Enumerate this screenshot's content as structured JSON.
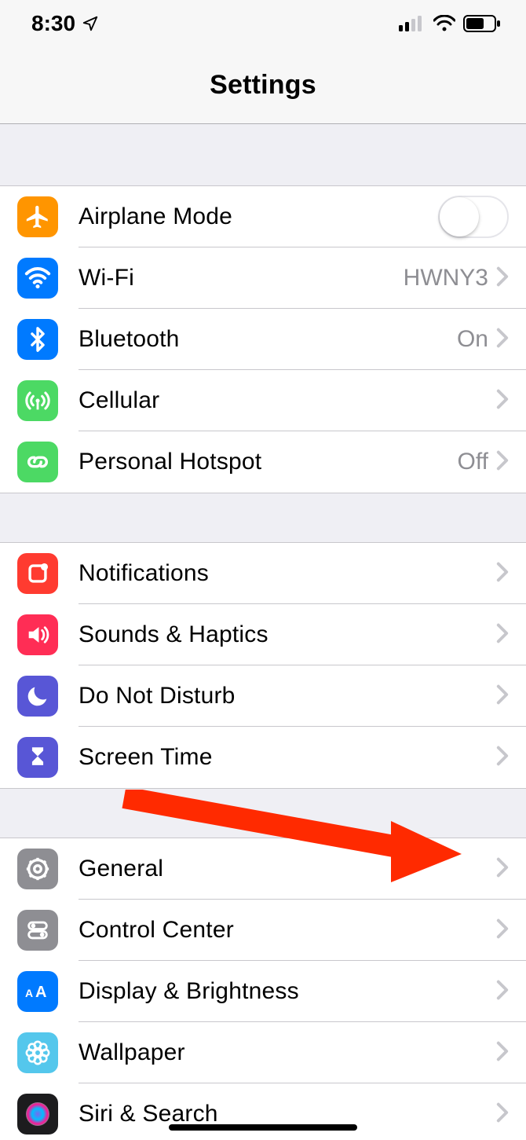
{
  "status": {
    "time": "8:30",
    "location_icon": "location-arrow",
    "signal_bars": 2,
    "wifi": true,
    "battery_pct": 60
  },
  "header": {
    "title": "Settings"
  },
  "groups": [
    {
      "rows": [
        {
          "id": "airplane-mode",
          "icon": "airplane",
          "icon_bg": "#ff9500",
          "label": "Airplane Mode",
          "control": "switch",
          "switch_on": false
        },
        {
          "id": "wifi",
          "icon": "wifi",
          "icon_bg": "#007aff",
          "label": "Wi-Fi",
          "value": "HWNY3",
          "control": "disclosure"
        },
        {
          "id": "bluetooth",
          "icon": "bluetooth",
          "icon_bg": "#007aff",
          "label": "Bluetooth",
          "value": "On",
          "control": "disclosure"
        },
        {
          "id": "cellular",
          "icon": "antenna",
          "icon_bg": "#4cd964",
          "label": "Cellular",
          "control": "disclosure"
        },
        {
          "id": "personal-hotspot",
          "icon": "link",
          "icon_bg": "#4cd964",
          "label": "Personal Hotspot",
          "value": "Off",
          "control": "disclosure"
        }
      ]
    },
    {
      "rows": [
        {
          "id": "notifications",
          "icon": "notifications",
          "icon_bg": "#ff3b30",
          "label": "Notifications",
          "control": "disclosure"
        },
        {
          "id": "sounds",
          "icon": "speaker",
          "icon_bg": "#ff2d55",
          "label": "Sounds & Haptics",
          "control": "disclosure"
        },
        {
          "id": "dnd",
          "icon": "moon",
          "icon_bg": "#5856d6",
          "label": "Do Not Disturb",
          "control": "disclosure"
        },
        {
          "id": "screen-time",
          "icon": "hourglass",
          "icon_bg": "#5856d6",
          "label": "Screen Time",
          "control": "disclosure"
        }
      ]
    },
    {
      "rows": [
        {
          "id": "general",
          "icon": "gear",
          "icon_bg": "#8e8e93",
          "label": "General",
          "control": "disclosure"
        },
        {
          "id": "control-center",
          "icon": "switches",
          "icon_bg": "#8e8e93",
          "label": "Control Center",
          "control": "disclosure"
        },
        {
          "id": "display",
          "icon": "aa",
          "icon_bg": "#007aff",
          "label": "Display & Brightness",
          "control": "disclosure"
        },
        {
          "id": "wallpaper",
          "icon": "flower",
          "icon_bg": "#54c7ec",
          "label": "Wallpaper",
          "control": "disclosure"
        },
        {
          "id": "siri",
          "icon": "siri",
          "icon_bg": "#1c1c1e",
          "label": "Siri & Search",
          "control": "disclosure"
        }
      ]
    }
  ],
  "annotation": {
    "arrow_target": "general"
  }
}
